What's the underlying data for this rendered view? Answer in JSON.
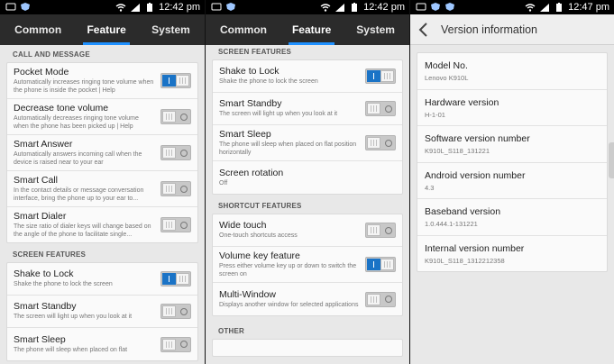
{
  "status": {
    "p1_time": "12:42 pm",
    "p2_time": "12:42 pm",
    "p3_time": "12:47 pm"
  },
  "tabs": [
    "Common",
    "Feature",
    "System"
  ],
  "panel1": {
    "section1": "CALL AND MESSAGE",
    "items1": [
      {
        "title": "Pocket Mode",
        "desc": "Automatically increases ringing tone volume when the phone is inside the pocket | Help",
        "on": true
      },
      {
        "title": "Decrease tone volume",
        "desc": "Automatically decreases ringing tone volume when the phone has been picked up | Help",
        "on": false
      },
      {
        "title": "Smart Answer",
        "desc": "Automatically answers incoming call when the device is raised near to your ear",
        "on": false
      },
      {
        "title": "Smart Call",
        "desc": "In the contact details or message conversation interface, bring the phone up to your ear to...",
        "on": false
      },
      {
        "title": "Smart Dialer",
        "desc": "The size ratio of dialer keys will change based on the angle of the phone to facilitate single...",
        "on": false
      }
    ],
    "section2": "SCREEN FEATURES",
    "items2": [
      {
        "title": "Shake to Lock",
        "desc": "Shake the phone to lock the screen",
        "on": true
      },
      {
        "title": "Smart Standby",
        "desc": "The screen will light up when you look at it",
        "on": false
      },
      {
        "title": "Smart Sleep",
        "desc": "The phone will sleep when placed on flat",
        "on": false
      }
    ]
  },
  "panel2": {
    "section1": "SCREEN FEATURES",
    "items1": [
      {
        "title": "Shake to Lock",
        "desc": "Shake the phone to lock the screen",
        "on": true
      },
      {
        "title": "Smart Standby",
        "desc": "The screen will light up when you look at it",
        "on": false
      },
      {
        "title": "Smart Sleep",
        "desc": "The phone will sleep when placed on flat position horizontally",
        "on": false
      },
      {
        "title": "Screen rotation",
        "desc": "Off"
      }
    ],
    "section2": "SHORTCUT FEATURES",
    "items2": [
      {
        "title": "Wide touch",
        "desc": "One-touch shortcuts access",
        "on": false
      },
      {
        "title": "Volume key feature",
        "desc": "Press either volume key up or down to switch the screen on",
        "on": true
      },
      {
        "title": "Multi-Window",
        "desc": "Displays another window for selected applications",
        "on": false
      }
    ],
    "section3": "OTHER"
  },
  "panel3": {
    "title": "Version information",
    "items": [
      {
        "title": "Model No.",
        "value": "Lenovo K910L"
      },
      {
        "title": "Hardware version",
        "value": "H-1-01"
      },
      {
        "title": "Software version number",
        "value": "K910L_S118_131221"
      },
      {
        "title": "Android version number",
        "value": "4.3"
      },
      {
        "title": "Baseband version",
        "value": "1.0.444.1-131221"
      },
      {
        "title": "Internal version number",
        "value": "K910L_S118_1312212358"
      }
    ]
  },
  "colors": {
    "accent": "#1e90ff",
    "toggle_on": "#1a73c6",
    "tabbar": "#2b2b2b"
  }
}
